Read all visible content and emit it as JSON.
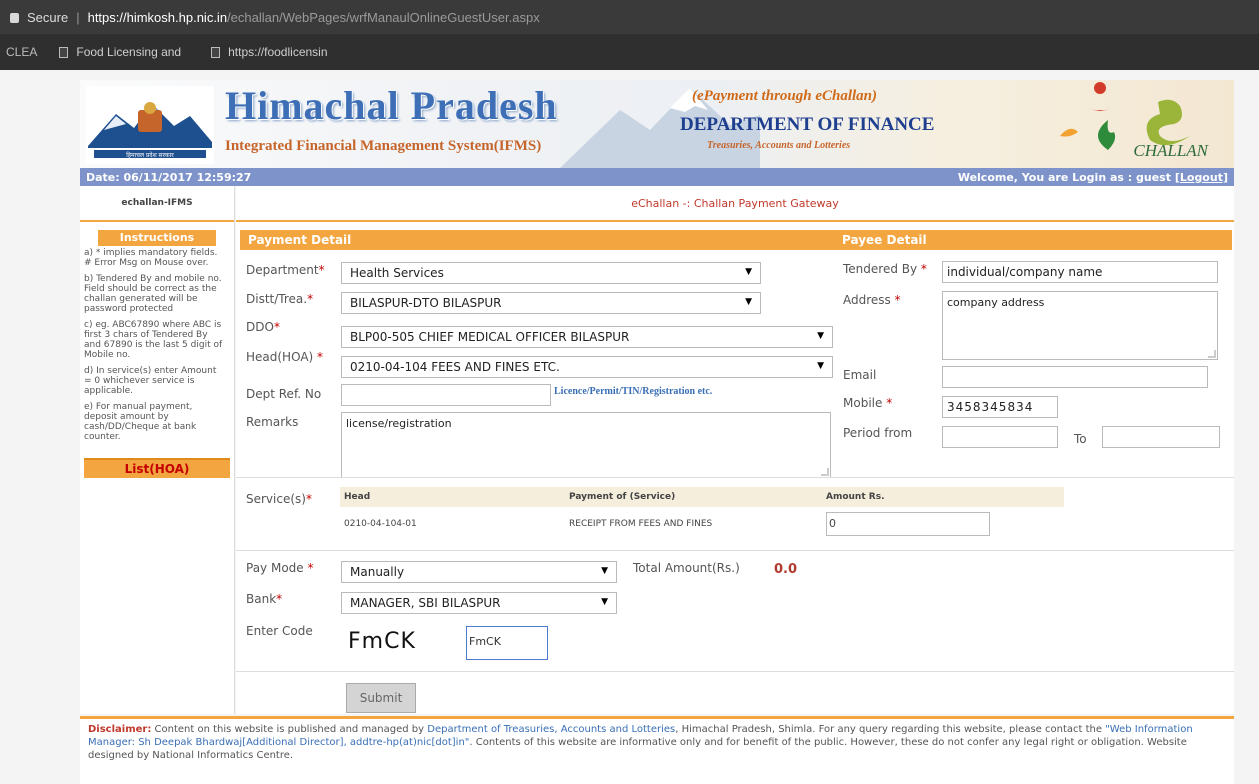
{
  "browser": {
    "secure_label": "Secure",
    "url_host": "https://himkosh.hp.nic.in",
    "url_path": "/echallan/WebPages/wrfManaulOnlineGuestUser.aspx",
    "bookmark_prefix": "CLEA",
    "bookmarks": [
      "Food Licensing and",
      "https://foodlicensin"
    ]
  },
  "banner": {
    "title": "Himachal Pradesh",
    "subtitle": "Integrated Financial Management System(IFMS)",
    "epayment": "(ePayment through eChallan)",
    "department": "DEPARTMENT OF FINANCE",
    "treasuries": "Treasuries, Accounts and Lotteries",
    "echallan_logo": "CHALLAN",
    "emblem_text": "हिमाचल प्रदेश सरकार"
  },
  "info_bar": {
    "date": "Date: 06/11/2017 12:59:27",
    "welcome": "Welcome, You are Login as : guest",
    "logout": "[Logout]"
  },
  "sidebar": {
    "header": "echallan-IFMS",
    "instructions_title": "Instructions",
    "items": [
      "a) * implies mandatory fields. # Error Msg on Mouse over.",
      "b) Tendered By and mobile no. Field should be correct as the challan generated will be password protected",
      "c) eg. ABC67890 where ABC is first 3 chars of Tendered By and 67890 is the last 5 digit of Mobile no.",
      "d) In service(s) enter Amount = 0 whichever service is applicable.",
      "e) For manual payment, deposit amount by cash/DD/Cheque at bank counter."
    ],
    "list_link": "List(HOA)"
  },
  "gateway_title": "eChallan -: Challan Payment Gateway",
  "payment_detail": {
    "heading": "Payment Detail",
    "department_label": "Department",
    "department_value": "Health Services",
    "distt_label": "Distt/Trea.",
    "distt_value": "BILASPUR-DTO BILASPUR",
    "ddo_label": "DDO",
    "ddo_value": "BLP00-505 CHIEF MEDICAL OFFICER BILASPUR",
    "head_label": "Head(HOA) ",
    "head_value": "0210-04-104 FEES AND FINES ETC.",
    "deptref_label": "Dept Ref. No",
    "deptref_value": "",
    "licence_hint": "Licence/Permit/TIN/Registration etc.",
    "remarks_label": "Remarks",
    "remarks_value": "license/registration"
  },
  "payee_detail": {
    "heading": "Payee Detail",
    "tendered_label": "Tendered By ",
    "tendered_value": "individual/company name",
    "address_label": "Address ",
    "address_value": "company address",
    "email_label": "Email",
    "email_value": "",
    "mobile_label": "Mobile ",
    "mobile_value": "3458345834",
    "period_label": "Period from",
    "to_label": "To"
  },
  "services": {
    "label": "Service(s)",
    "columns": [
      "Head",
      "Payment of (Service)",
      "Amount Rs."
    ],
    "rows": [
      {
        "head": "0210-04-104-01",
        "service": "RECEIPT FROM FEES AND FINES",
        "amount": "0"
      }
    ]
  },
  "payment": {
    "paymode_label": "Pay Mode ",
    "paymode_value": "Manually",
    "total_label": "Total Amount(Rs.)",
    "total_value": "0.0",
    "bank_label": "Bank",
    "bank_value": "MANAGER, SBI BILASPUR",
    "code_label": "Enter Code",
    "captcha": "FmCK",
    "code_value": "FmCK",
    "submit": "Submit"
  },
  "required_mark": "*",
  "footer": {
    "disclaimer": "Disclaimer:",
    "t1": " Content on this website is published and managed by ",
    "link1": "Department of Treasuries, Accounts and Lotteries",
    "t2": ", Himachal Pradesh, Shimla. For any query regarding this website, please contact the ",
    "link2": "\"Web Information Manager: Sh Deepak Bhardwaj[Additional Director], addtre-hp(at)nic[dot]in\"",
    "t3": ". Contents of this website are informative only and for benefit of the public. However, these do not confer any legal right or obligation. Website designed by National Informatics Centre."
  }
}
